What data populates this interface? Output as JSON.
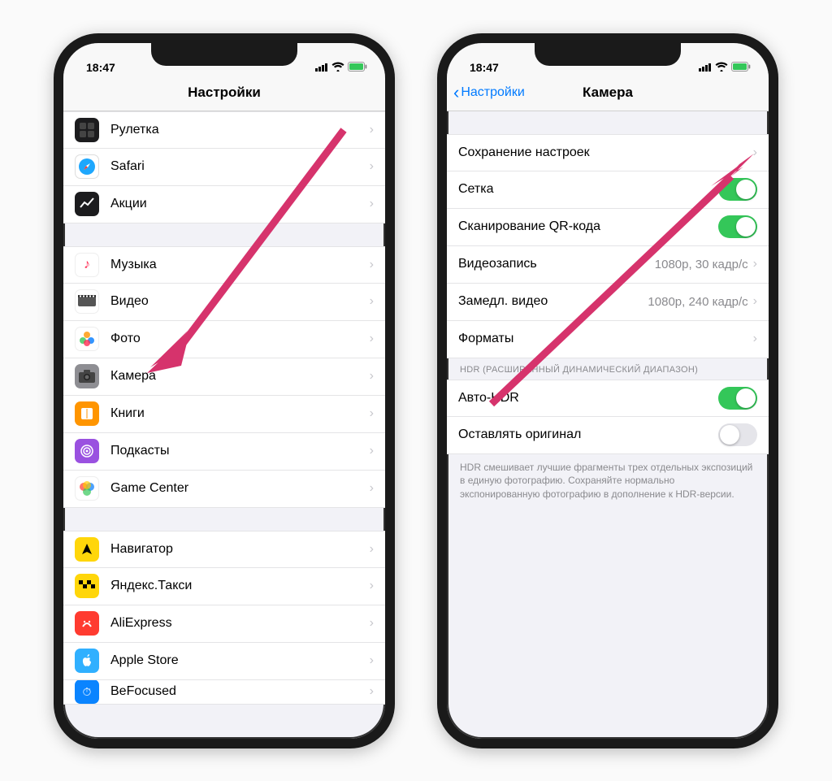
{
  "status": {
    "time": "18:47"
  },
  "left": {
    "title": "Настройки",
    "group1": [
      {
        "label": "Рулетка",
        "icon": "ruler-icon",
        "cls": "ic-ruler"
      },
      {
        "label": "Safari",
        "icon": "safari-icon",
        "cls": "ic-safari"
      },
      {
        "label": "Акции",
        "icon": "stocks-icon",
        "cls": "ic-stocks"
      }
    ],
    "group2": [
      {
        "label": "Музыка",
        "icon": "music-icon",
        "cls": "ic-music"
      },
      {
        "label": "Видео",
        "icon": "video-icon",
        "cls": "ic-video"
      },
      {
        "label": "Фото",
        "icon": "photos-icon",
        "cls": "ic-photos"
      },
      {
        "label": "Камера",
        "icon": "camera-icon",
        "cls": "ic-camera"
      },
      {
        "label": "Книги",
        "icon": "books-icon",
        "cls": "ic-books"
      },
      {
        "label": "Подкасты",
        "icon": "podcasts-icon",
        "cls": "ic-podcasts"
      },
      {
        "label": "Game Center",
        "icon": "gamecenter-icon",
        "cls": "ic-gc"
      }
    ],
    "group3": [
      {
        "label": "Навигатор",
        "icon": "navigator-icon",
        "cls": "ic-nav"
      },
      {
        "label": "Яндекс.Такси",
        "icon": "taxi-icon",
        "cls": "ic-taxi"
      },
      {
        "label": "AliExpress",
        "icon": "aliexpress-icon",
        "cls": "ic-ali"
      },
      {
        "label": "Apple Store",
        "icon": "applestore-icon",
        "cls": "ic-apple"
      },
      {
        "label": "BeFocused",
        "icon": "befocused-icon",
        "cls": "ic-bef"
      }
    ]
  },
  "right": {
    "back": "Настройки",
    "title": "Камера",
    "rows": {
      "save": "Сохранение настроек",
      "grid": "Сетка",
      "qr": "Сканирование QR-кода",
      "video": "Видеозапись",
      "video_detail": "1080p, 30 кадр/с",
      "slomo": "Замедл. видео",
      "slomo_detail": "1080p, 240 кадр/с",
      "formats": "Форматы"
    },
    "hdr_header": "HDR (РАСШИРЕННЫЙ ДИНАМИЧЕСКИЙ ДИАПАЗОН)",
    "auto_hdr": "Авто-HDR",
    "keep_original": "Оставлять оригинал",
    "hdr_footer": "HDR смешивает лучшие фрагменты трех отдельных экспозиций в единую фотографию. Сохраняйте нормально экспонированную фотографию в дополнение к HDR-версии."
  }
}
